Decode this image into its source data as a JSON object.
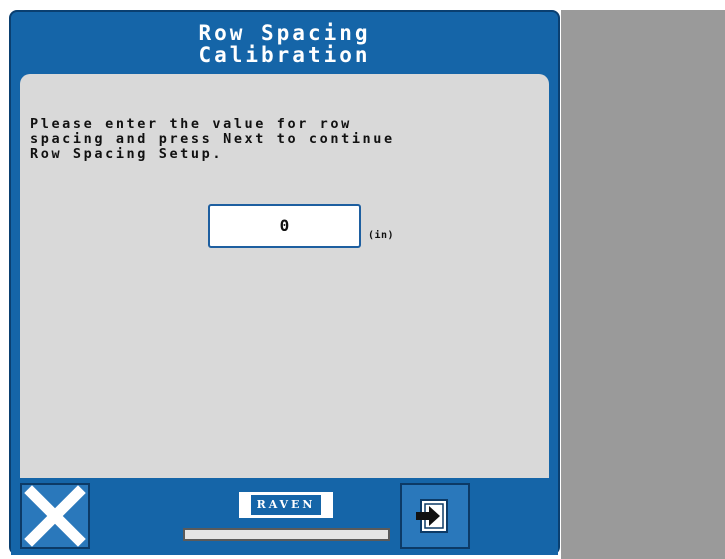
{
  "dialog": {
    "title_line1": "Row Spacing",
    "title_line2": "Calibration"
  },
  "message": {
    "line1": "Please enter the value for row",
    "line2": "spacing and press Next to continue",
    "line3": "Row Spacing Setup."
  },
  "row_spacing": {
    "value": "0",
    "unit": "(in)"
  },
  "logo": {
    "text": "RAVEN"
  },
  "progress": {
    "fraction": 0.0
  },
  "icons": {
    "cancel": "close-x-icon",
    "next": "next-arrow-icon"
  },
  "colors": {
    "header_blue": "#1565a8",
    "button_blue": "#2a78bb",
    "content_gray": "#d9d9d9",
    "side_gray": "#9a9a9a"
  }
}
